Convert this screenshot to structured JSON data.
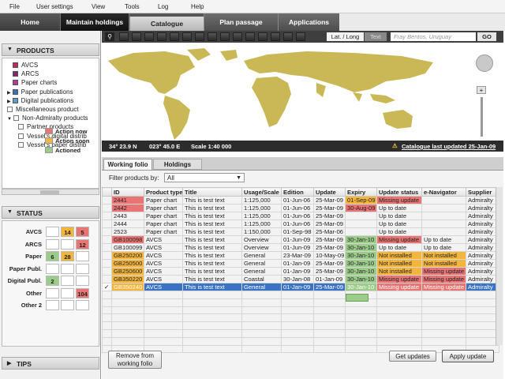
{
  "menu": [
    "File",
    "User settings",
    "View",
    "Tools",
    "Log",
    "Help"
  ],
  "main_tabs": [
    "Home",
    "Maintain holdings",
    "Catalogue",
    "Plan passage",
    "Applications"
  ],
  "coords_toggle": {
    "latlong": "Lat. / Long",
    "text": "Text"
  },
  "search": {
    "value": "Fray Bentos, Uruguay",
    "go": "GO"
  },
  "products_panel": {
    "title": "PRODUCTS",
    "items": [
      {
        "label": "AVCS",
        "color": "#c0295a"
      },
      {
        "label": "ARCS",
        "color": "#7a2a6e"
      },
      {
        "label": "Paper charts",
        "color": "#b03a9a"
      },
      {
        "label": "Paper publications",
        "color": "#3d6fb5"
      },
      {
        "label": "Digital publications",
        "color": "#5a9ec9"
      },
      {
        "label": "Miscellaneous product",
        "color": ""
      },
      {
        "label": "Non-Admiralty products",
        "color": ""
      },
      {
        "label": "Partner products",
        "color": ""
      },
      {
        "label": "Vessel's digital distrib",
        "color": ""
      },
      {
        "label": "Vessel's paper distrib",
        "color": ""
      }
    ]
  },
  "status_panel": {
    "title": "STATUS",
    "rows": [
      {
        "label": "AVCS",
        "cells": [
          "",
          "14",
          "5"
        ]
      },
      {
        "label": "ARCS",
        "cells": [
          "",
          "",
          "12"
        ]
      },
      {
        "label": "Paper",
        "cells": [
          "6",
          "28",
          ""
        ]
      },
      {
        "label": "Paper Publ.",
        "cells": [
          "",
          "",
          ""
        ]
      },
      {
        "label": "Digital Publ.",
        "cells": [
          "2",
          "",
          ""
        ]
      },
      {
        "label": "Other",
        "cells": [
          "",
          "",
          "104"
        ]
      },
      {
        "label": "Other 2",
        "cells": [
          "",
          "",
          ""
        ]
      }
    ],
    "legend": [
      {
        "label": "Action now",
        "color": "#e87474"
      },
      {
        "label": "Action soon",
        "color": "#f4b53c"
      },
      {
        "label": "Actioned",
        "color": "#9ccc8a"
      }
    ]
  },
  "tips_label": "TIPS",
  "map": {
    "lat": "34° 23.9 N",
    "lon": "023° 45.0  E",
    "scale": "Scale 1:40 000",
    "catalogue": "Catalogue last updated 25-Jan-09"
  },
  "folio_tabs": [
    "Working folio",
    "Holdings"
  ],
  "filter": {
    "label": "Filter products by:",
    "value": "All"
  },
  "table": {
    "headers": [
      "",
      "ID",
      "Product type",
      "Title",
      "Usage/Scale",
      "Edition",
      "Update",
      "Expiry",
      "Update status",
      "e-Navigator",
      "Supplier"
    ],
    "rows": [
      {
        "cells": [
          "",
          "2441",
          "Paper chart",
          "This is test text",
          "1:125,000",
          "01-Jun-06",
          "25-Mar-09",
          "01-Sep-09",
          "Missing update",
          "",
          "Admiralty"
        ],
        "hl": {
          "1": "red",
          "7": "org",
          "8": "red"
        }
      },
      {
        "cells": [
          "",
          "2442",
          "Paper chart",
          "This is test text",
          "1:125,000",
          "01-Jun-06",
          "25-Mar-09",
          "30-Aug-09",
          "Up to date",
          "",
          "Admiralty"
        ],
        "hl": {
          "1": "red",
          "7": "red"
        }
      },
      {
        "cells": [
          "",
          "2443",
          "Paper chart",
          "This is test text",
          "1:125,000",
          "01-Jun-06",
          "25-Mar-09",
          "",
          "Up to date",
          "",
          "Admiralty"
        ],
        "hl": {}
      },
      {
        "cells": [
          "",
          "2444",
          "Paper chart",
          "This is test text",
          "1:125,000",
          "01-Jun-06",
          "25-Mar-09",
          "",
          "Up to date",
          "",
          "Admiralty"
        ],
        "hl": {}
      },
      {
        "cells": [
          "",
          "2523",
          "Paper chart",
          "This is test text",
          "1:150,000",
          "01-Sep-98",
          "25-Mar-06",
          "",
          "Up to date",
          "",
          "Admiralty"
        ],
        "hl": {}
      },
      {
        "cells": [
          "",
          "GB100098",
          "AVCS",
          "This is test text",
          "Overview",
          "01-Jun-09",
          "25-Mar-09",
          "30-Jan-10",
          "Missing update",
          "Up to date",
          "Admiralty"
        ],
        "hl": {
          "1": "red",
          "7": "grn",
          "8": "red"
        }
      },
      {
        "cells": [
          "",
          "GB100099",
          "AVCS",
          "This is test text",
          "Overview",
          "01-Jun-09",
          "25-Mar-09",
          "30-Jan-10",
          "Up to date",
          "Up to date",
          "Admiralty"
        ],
        "hl": {
          "7": "grn"
        }
      },
      {
        "cells": [
          "",
          "GB250200",
          "AVCS",
          "This is test text",
          "General",
          "23-Mar-09",
          "10-May-09",
          "30-Jan-10",
          "Not installed",
          "Not installed",
          "Admiralty"
        ],
        "hl": {
          "1": "org",
          "7": "grn",
          "8": "org",
          "9": "org"
        }
      },
      {
        "cells": [
          "",
          "GB250500",
          "AVCS",
          "This is test text",
          "General",
          "01-Jan-09",
          "25-Mar-09",
          "30-Jan-10",
          "Not installed",
          "Not installed",
          "Admiralty"
        ],
        "hl": {
          "1": "org",
          "7": "grn",
          "8": "org",
          "9": "org"
        }
      },
      {
        "cells": [
          "",
          "GB250600",
          "AVCS",
          "This is test text",
          "General",
          "01-Jan-09",
          "25-Mar-09",
          "30-Jan-10",
          "Not installed",
          "Missing update",
          "Admiralty"
        ],
        "hl": {
          "1": "org",
          "7": "grn",
          "8": "org",
          "9": "red"
        }
      },
      {
        "cells": [
          "",
          "GB350220",
          "AVCS",
          "This is test text",
          "Coastal",
          "30-Jan-08",
          "01-Jan-09",
          "30-Jan-10",
          "Missing update",
          "Missing update",
          "Admiralty"
        ],
        "hl": {
          "1": "org",
          "7": "grn",
          "8": "red",
          "9": "red"
        }
      },
      {
        "cells": [
          "✓",
          "GB350240",
          "AVCS",
          "This is test text",
          "General",
          "01-Jan-09",
          "25-Mar-09",
          "30-Jan-10",
          "Missing update",
          "Missing update",
          "Admiralty"
        ],
        "hl": {
          "1": "org",
          "7": "grn",
          "8": "red",
          "9": "red"
        },
        "selected": true
      }
    ]
  },
  "buttons": {
    "remove": "Remove from\nworking folio",
    "get": "Get updates",
    "apply": "Apply update"
  }
}
